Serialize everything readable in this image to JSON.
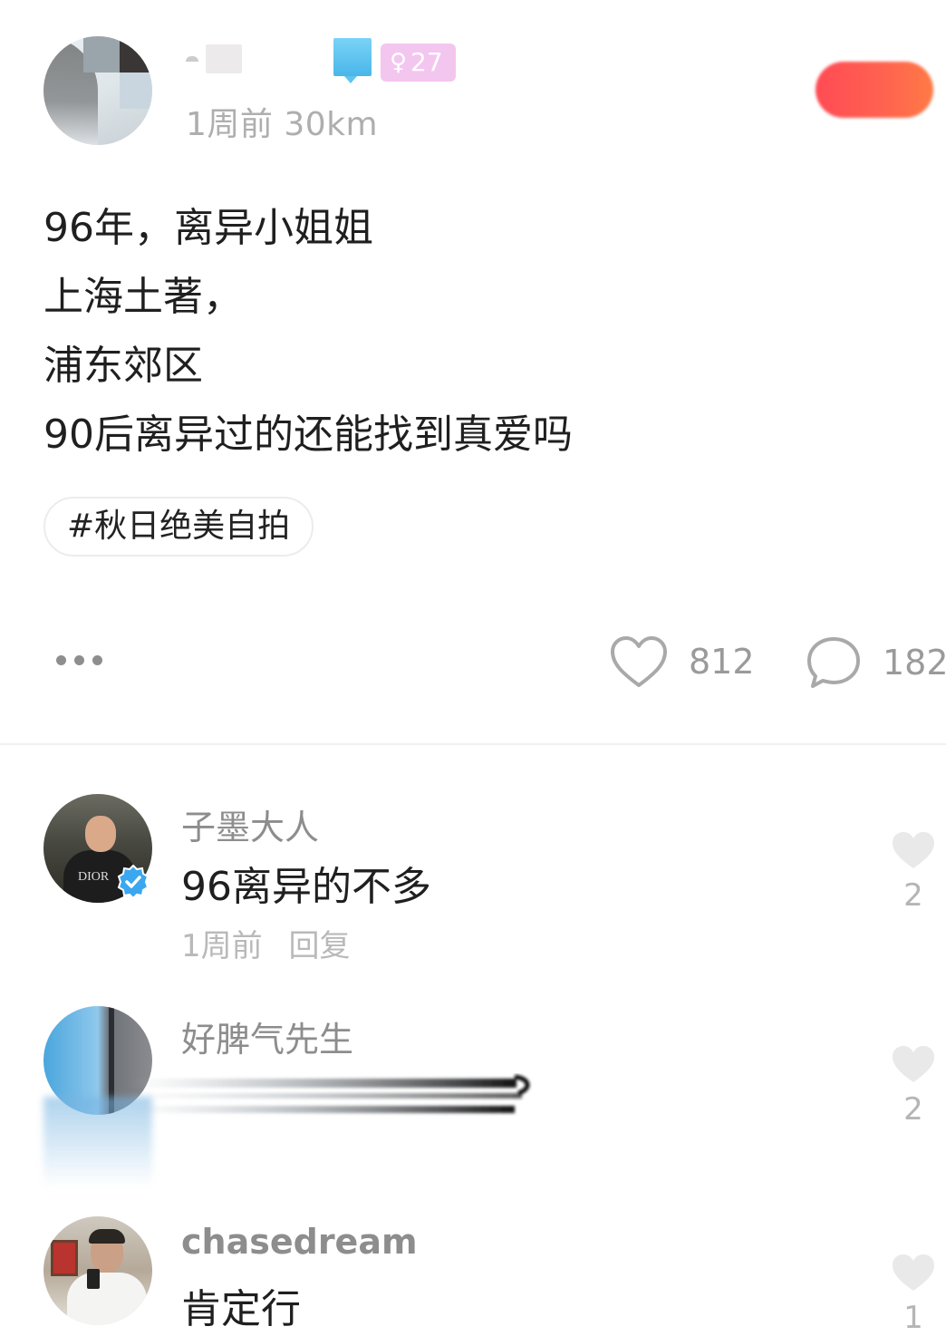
{
  "post": {
    "author_age": "27",
    "gender_symbol": "♀",
    "time": "1周前",
    "distance": "30km",
    "content_lines": [
      "96年，离异小姐姐",
      "上海土著，",
      "浦东郊区",
      "90后离异过的还能找到真爱吗"
    ],
    "topic": "#秋日绝美自拍",
    "likes": "812",
    "comments": "182"
  },
  "comments": [
    {
      "name": "子墨大人",
      "text": "96离异的不多",
      "time": "1周前",
      "reply_label": "回复",
      "likes": "2",
      "avatar_logo": "DIOR"
    },
    {
      "name": "好脾气先生",
      "text": "",
      "likes": "2"
    },
    {
      "name": "chasedream",
      "text": "肯定行",
      "likes": "1"
    }
  ],
  "colors": {
    "follow_button": "#ff5a4f",
    "vip_badge": "#5fc4ef",
    "gender_badge": "#f3c6ef",
    "verified": "#3aa7f0"
  }
}
